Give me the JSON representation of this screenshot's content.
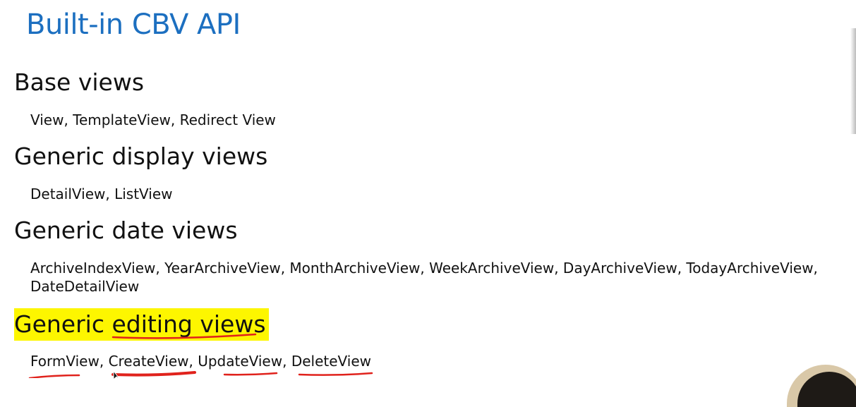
{
  "slide": {
    "title": "Built-in CBV API",
    "sections": [
      {
        "heading": "Base views",
        "items": "View, TemplateView, Redirect View"
      },
      {
        "heading": "Generic display views",
        "items": "DetailView, ListView"
      },
      {
        "heading": "Generic date views",
        "items_line1": "ArchiveIndexView, YearArchiveView, MonthArchiveView, WeekArchiveView, DayArchiveView, TodayArchiveView,",
        "items_line2": "DateDetailView"
      },
      {
        "heading_part1": "Generic ",
        "heading_part2": "editing views",
        "items_part1": "FormView",
        "items_part2": ", ",
        "items_part3": "CreateView",
        "items_part4": ", ",
        "items_part5": "UpdateView",
        "items_part6": ", ",
        "items_part7": "DeleteView"
      }
    ]
  },
  "colors": {
    "title": "#1c6fc0",
    "highlight": "#fdf600",
    "annotation": "#e0221c"
  }
}
